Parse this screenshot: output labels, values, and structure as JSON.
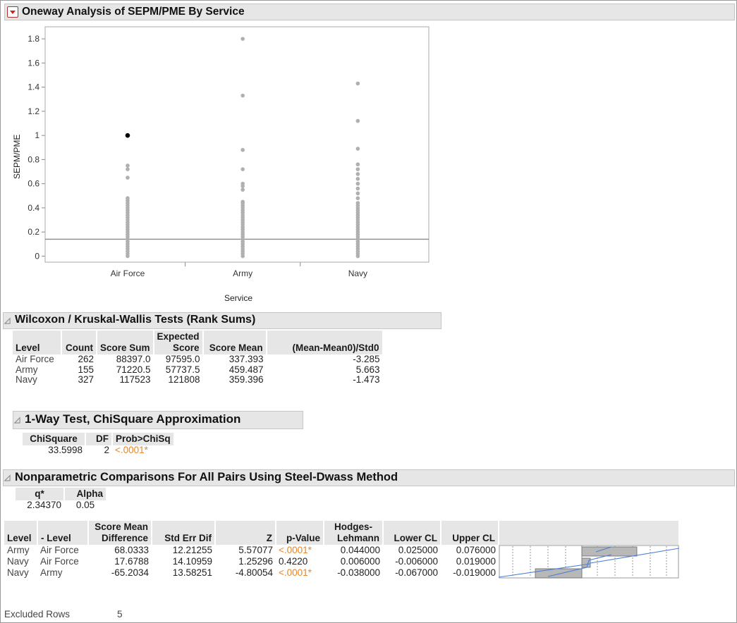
{
  "main_header": {
    "title": "Oneway Analysis of SEPM/PME By Service"
  },
  "chart_data": {
    "type": "scatter",
    "title": "",
    "xlabel": "Service",
    "ylabel": "SEPM/PME",
    "categories": [
      "Air Force",
      "Army",
      "Navy"
    ],
    "yticks": [
      "0",
      "0.2",
      "0.4",
      "0.6",
      "0.8",
      "1",
      "1.2",
      "1.4",
      "1.6",
      "1.8"
    ],
    "ylim": [
      -0.05,
      1.9
    ],
    "grid": false,
    "reference_line": 0.14,
    "highlighted_point": {
      "category": "Air Force",
      "y": 1.0
    },
    "series": [
      {
        "category": "Air Force",
        "y": [
          0.75,
          0.72,
          0.65,
          0.48,
          0.46,
          0.44,
          0.42,
          0.4,
          0.38,
          0.36,
          0.34,
          0.32,
          0.3,
          0.28,
          0.26,
          0.24,
          0.22,
          0.2,
          0.18,
          0.16,
          0.14,
          0.12,
          0.1,
          0.08,
          0.06,
          0.04,
          0.02,
          0.0
        ]
      },
      {
        "category": "Army",
        "y": [
          1.8,
          1.33,
          0.88,
          0.72,
          0.6,
          0.58,
          0.55,
          0.45,
          0.44,
          0.42,
          0.4,
          0.38,
          0.36,
          0.34,
          0.32,
          0.3,
          0.28,
          0.26,
          0.24,
          0.22,
          0.2,
          0.18,
          0.16,
          0.14,
          0.12,
          0.1,
          0.08,
          0.06,
          0.04,
          0.02,
          0.0
        ]
      },
      {
        "category": "Navy",
        "y": [
          1.43,
          1.12,
          0.89,
          0.76,
          0.72,
          0.68,
          0.64,
          0.6,
          0.56,
          0.52,
          0.48,
          0.44,
          0.42,
          0.4,
          0.38,
          0.36,
          0.34,
          0.32,
          0.3,
          0.28,
          0.26,
          0.24,
          0.22,
          0.2,
          0.18,
          0.16,
          0.14,
          0.12,
          0.1,
          0.08,
          0.06,
          0.04,
          0.02,
          0.0
        ]
      }
    ]
  },
  "wilcoxon": {
    "title": "Wilcoxon / Kruskal-Wallis Tests (Rank Sums)",
    "headers": {
      "level": "Level",
      "count": "Count",
      "score_sum": "Score Sum",
      "expected_1": "Expected",
      "expected_2": "Score",
      "score_mean": "Score Mean",
      "std": "(Mean-Mean0)/Std0"
    },
    "rows": [
      [
        "Air Force",
        "262",
        "88397.0",
        "97595.0",
        "337.393",
        "-3.285"
      ],
      [
        "Army",
        "155",
        "71220.5",
        "57737.5",
        "459.487",
        "5.663"
      ],
      [
        "Navy",
        "327",
        "117523",
        "121808",
        "359.396",
        "-1.473"
      ]
    ]
  },
  "oneway": {
    "title": "1-Way Test, ChiSquare Approximation",
    "headers": {
      "chisq": "ChiSquare",
      "df": "DF",
      "prob": "Prob>ChiSq"
    },
    "values": {
      "chisq": "33.5998",
      "df": "2",
      "prob": "<.0001*"
    }
  },
  "nonparam": {
    "title": "Nonparametric Comparisons For All Pairs Using Steel-Dwass  Method",
    "q_header": "q*",
    "alpha_header": "Alpha",
    "q_value": "2.34370",
    "alpha_value": "0.05",
    "headers": {
      "level": "Level",
      "minus_level": "- Level",
      "smd_1": "Score Mean",
      "smd_2": "Difference",
      "std_err": "Std Err Dif",
      "z": "Z",
      "p": "p-Value",
      "hl_1": "Hodges-",
      "hl_2": "Lehmann",
      "lower": "Lower CL",
      "upper": "Upper CL"
    },
    "rows": [
      [
        "Army",
        "Air Force",
        "68.0333",
        "12.21255",
        "5.57077",
        "<.0001*",
        "0.044000",
        "0.025000",
        "0.076000"
      ],
      [
        "Navy",
        "Air Force",
        "17.6788",
        "14.10959",
        "1.25296",
        "0.4220",
        "0.006000",
        "-0.006000",
        "0.019000"
      ],
      [
        "Navy",
        "Army",
        "-65.2034",
        "13.58251",
        "-4.80054",
        "<.0001*",
        "-0.038000",
        "-0.067000",
        "-0.019000"
      ]
    ],
    "significant": [
      true,
      false,
      true
    ]
  },
  "footer": {
    "excluded_label": "Excluded Rows",
    "excluded_value": "5"
  },
  "colors": {
    "header_bg": "#e6e6e6",
    "significant": "#e8862a",
    "bar": "#b8b8b8",
    "fit_line": "#4a7fd4"
  }
}
